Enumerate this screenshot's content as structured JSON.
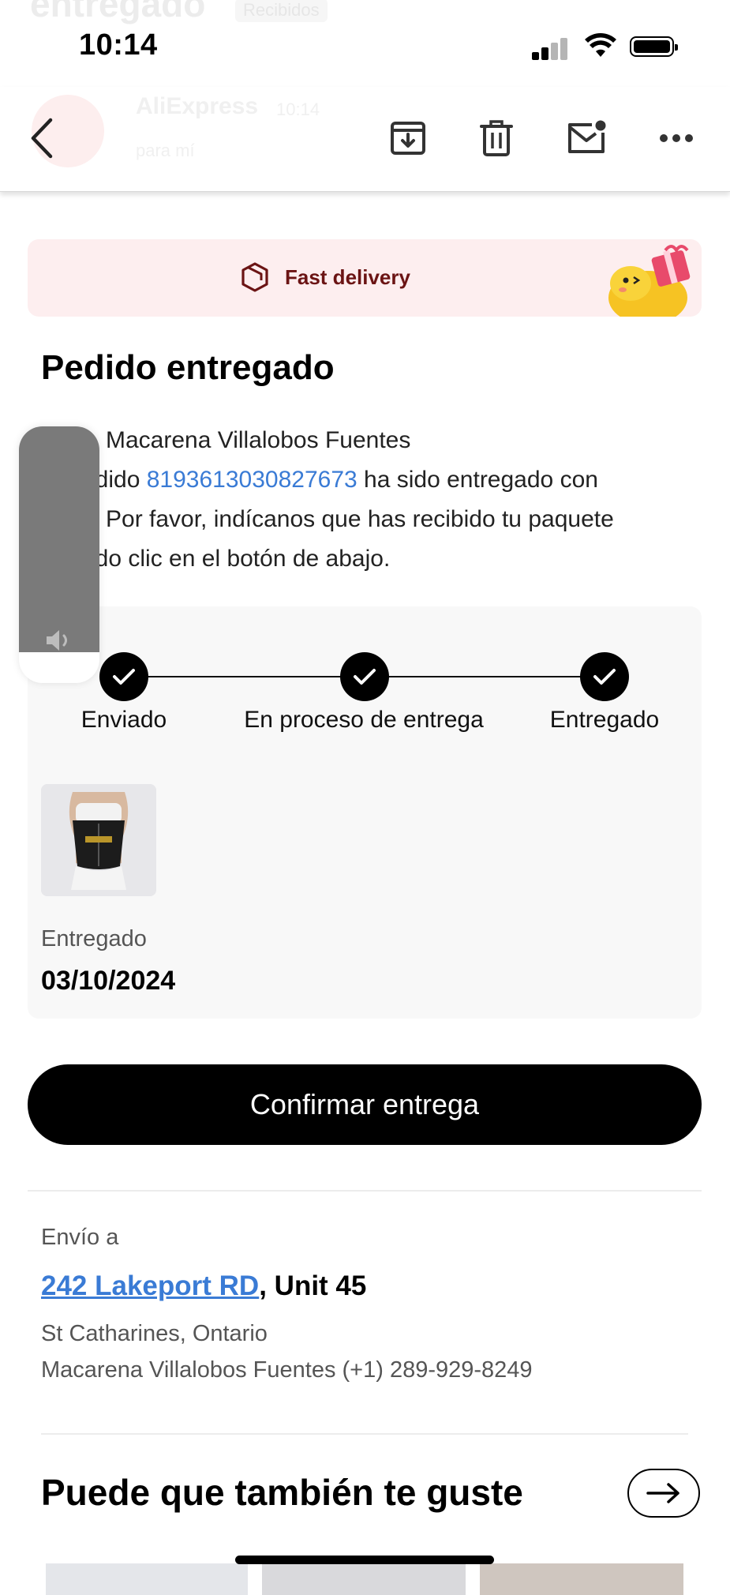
{
  "ghost_header": {
    "title": "entregado",
    "badge": "Recibidos",
    "sender": "AliExpress",
    "time": "10:14",
    "to": "para mí"
  },
  "status_bar": {
    "time": "10:14"
  },
  "toolbar": {
    "back_icon": "chevron-left-icon",
    "archive_icon": "archive-icon",
    "delete_icon": "trash-icon",
    "unread_icon": "mail-unread-icon",
    "more_icon": "more-horizontal-icon"
  },
  "banner": {
    "label": "Fast delivery",
    "icon": "package-icon"
  },
  "order": {
    "title": "Pedido entregado",
    "greeting": "Macarena Villalobos Fuentes",
    "line2_pre": "edido ",
    "order_number": "8193613030827673",
    "line2_post": " ha sido entregado con",
    "line3": " Por favor, indícanos que has recibido tu paquete",
    "line4": "ndo clic en el botón de abajo."
  },
  "tracking": {
    "steps": [
      {
        "label": "Enviado"
      },
      {
        "label": "En proceso de entrega"
      },
      {
        "label": "Entregado"
      }
    ],
    "delivered_label": "Entregado",
    "delivered_date": "03/10/2024"
  },
  "confirm_button": "Confirmar entrega",
  "shipping": {
    "label": "Envío a",
    "street": "242 Lakeport RD",
    "unit": ", Unit 45",
    "city": "St Catharines, Ontario",
    "contact": "Macarena Villalobos Fuentes (+1) 289-929-8249"
  },
  "recommendations": {
    "title": "Puede que también te guste"
  },
  "volume_hud": {
    "level": 0.88,
    "icon": "speaker-icon"
  },
  "colors": {
    "accent_link": "#3a7bd5",
    "banner_bg": "#fdeeef",
    "banner_text": "#6b1414"
  }
}
